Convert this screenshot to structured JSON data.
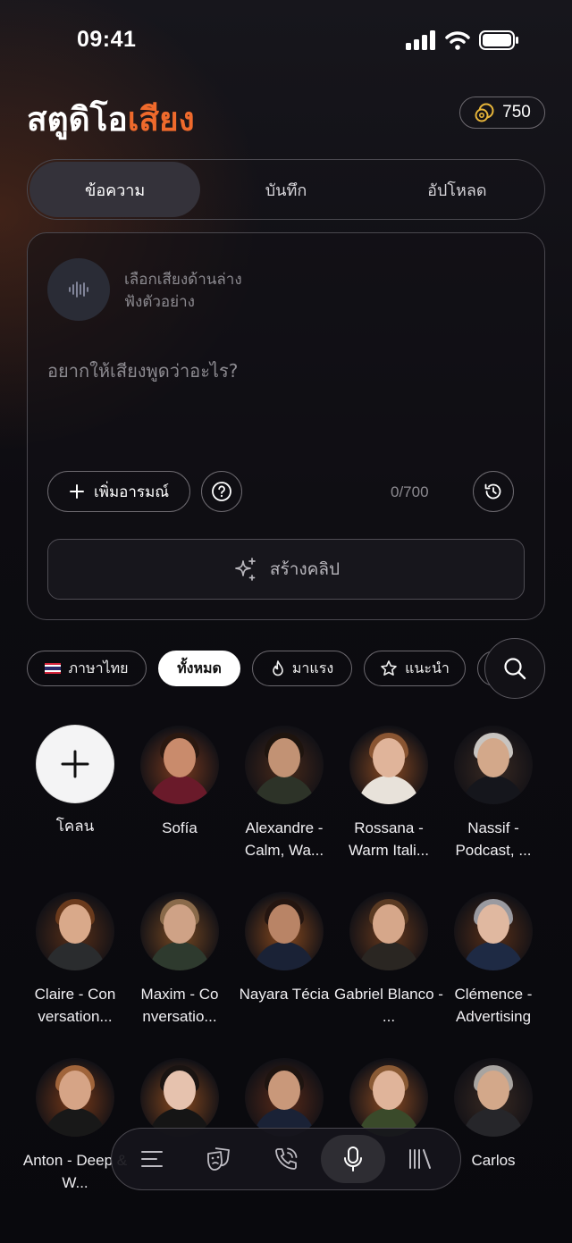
{
  "status_bar": {
    "time": "09:41"
  },
  "header": {
    "title_main": "สตูดิโอ",
    "title_accent": "เสียง",
    "coins": "750"
  },
  "tabs": [
    {
      "label": "ข้อความ",
      "active": true
    },
    {
      "label": "บันทึก",
      "active": false
    },
    {
      "label": "อัปโหลด",
      "active": false
    }
  ],
  "editor": {
    "hint_line1": "เลือกเสียงด้านล่าง",
    "hint_line2": "ฟังตัวอย่าง",
    "prompt_placeholder": "อยากให้เสียงพูดว่าอะไร?",
    "add_emotion_label": "เพิ่มอารมณ์",
    "counter": "0/700",
    "create_label": "สร้างคลิป"
  },
  "filters": [
    {
      "label": "ภาษาไทย",
      "icon": "thai-flag-icon"
    },
    {
      "label": "ทั้งหมด",
      "active": true
    },
    {
      "label": "มาแรง",
      "icon": "flame-icon"
    },
    {
      "label": "แนะนำ",
      "icon": "star-icon"
    }
  ],
  "voices": [
    {
      "name": "โคลน",
      "clone": true
    },
    {
      "name": "Sofía",
      "skin": "#c98b6c",
      "hair": "#2a1810",
      "cloth": "#6a1a2a",
      "glow": "#7a3a1e"
    },
    {
      "name": "Alexandre - Calm, Wa...",
      "skin": "#c29274",
      "hair": "#1e140e",
      "cloth": "#2d3328",
      "glow": "#4a2a1a"
    },
    {
      "name": "Rossana - Warm Itali...",
      "skin": "#e0b49a",
      "hair": "#8a5532",
      "cloth": "#e8e2da",
      "glow": "#8a4a22"
    },
    {
      "name": "Nassif - Podcast, ...",
      "skin": "#d3a88a",
      "hair": "#c8c4c0",
      "cloth": "#15161c",
      "glow": "#3a2a22"
    },
    {
      "name": "Claire - Con versation...",
      "skin": "#d9a98a",
      "hair": "#6a3a1c",
      "cloth": "#2a2c2e",
      "glow": "#5a3018"
    },
    {
      "name": "Maxim - Co nversatio...",
      "skin": "#cfa286",
      "hair": "#8a6a4a",
      "cloth": "#2e3a2e",
      "glow": "#7a4a22"
    },
    {
      "name": "Nayara Técia",
      "skin": "#b98466",
      "hair": "#241510",
      "cloth": "#1a2236",
      "glow": "#8a4a1e"
    },
    {
      "name": "Gabriel Blanco - ...",
      "skin": "#d6a78a",
      "hair": "#5a3a22",
      "cloth": "#2a2622",
      "glow": "#6a3a1c"
    },
    {
      "name": "Clémence - Advertising",
      "skin": "#e0b8a0",
      "hair": "#9a9aa0",
      "cloth": "#1e2a44",
      "glow": "#5a3018"
    },
    {
      "name": "Anton - Deep & W...",
      "skin": "#d6a486",
      "hair": "#a0643a",
      "cloth": "#181818",
      "glow": "#7a3a18"
    },
    {
      "name": "",
      "skin": "#e6c2ae",
      "hair": "#1a1412",
      "cloth": "#151515",
      "glow": "#8a4a1e"
    },
    {
      "name": "",
      "skin": "#c9987a",
      "hair": "#1e1410",
      "cloth": "#1a2236",
      "glow": "#5a2a18"
    },
    {
      "name": "",
      "skin": "#e0b49a",
      "hair": "#8a5a34",
      "cloth": "#3a4a2a",
      "glow": "#8a4a22"
    },
    {
      "name": "Carlos",
      "skin": "#d3a88a",
      "hair": "#a8a4a0",
      "cloth": "#26262a",
      "glow": "#3a2a22"
    }
  ],
  "bottom_nav": [
    {
      "icon": "menu-icon"
    },
    {
      "icon": "masks-icon"
    },
    {
      "icon": "phone-icon"
    },
    {
      "icon": "microphone-icon",
      "active": true
    },
    {
      "icon": "library-icon"
    }
  ]
}
